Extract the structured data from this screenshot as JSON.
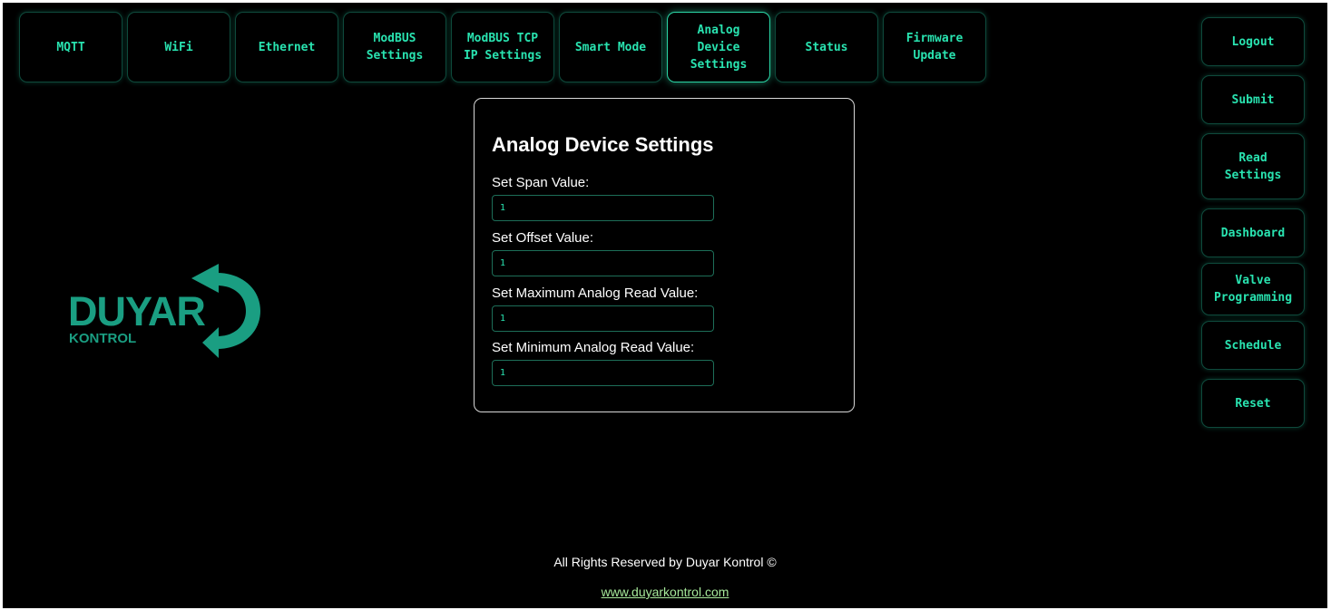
{
  "nav": {
    "tabs": [
      {
        "label": "MQTT"
      },
      {
        "label": "WiFi"
      },
      {
        "label": "Ethernet"
      },
      {
        "label": "ModBUS\nSettings"
      },
      {
        "label": "ModBUS TCP\nIP Settings"
      },
      {
        "label": "Smart Mode"
      },
      {
        "label": "Analog\nDevice\nSettings",
        "active": true
      },
      {
        "label": "Status"
      },
      {
        "label": "Firmware\nUpdate"
      }
    ]
  },
  "sidebar": {
    "buttons": [
      {
        "label": "Logout"
      },
      {
        "label": "Submit"
      },
      {
        "label": "Read\nSettings"
      },
      {
        "label": "Dashboard"
      },
      {
        "label": "Valve\nProgramming"
      },
      {
        "label": "Schedule"
      },
      {
        "label": "Reset"
      }
    ]
  },
  "form": {
    "title": "Analog Device Settings",
    "fields": [
      {
        "label": "Set Span Value:",
        "value": "1"
      },
      {
        "label": "Set Offset Value:",
        "value": "1"
      },
      {
        "label": "Set Maximum Analog Read Value:",
        "value": "1"
      },
      {
        "label": "Set Minimum Analog Read Value:",
        "value": "1"
      }
    ]
  },
  "logo": {
    "name": "DUYAR",
    "sub": "KONTROL",
    "icon": "circular-arrows-icon"
  },
  "footer": {
    "rights": "All Rights Reserved by Duyar Kontrol ©",
    "link": "www.duyarkontrol.com"
  },
  "colors": {
    "background": "#000000",
    "accent": "#29e3b0",
    "brand": "#1a9e82",
    "link": "#a6e89a"
  }
}
